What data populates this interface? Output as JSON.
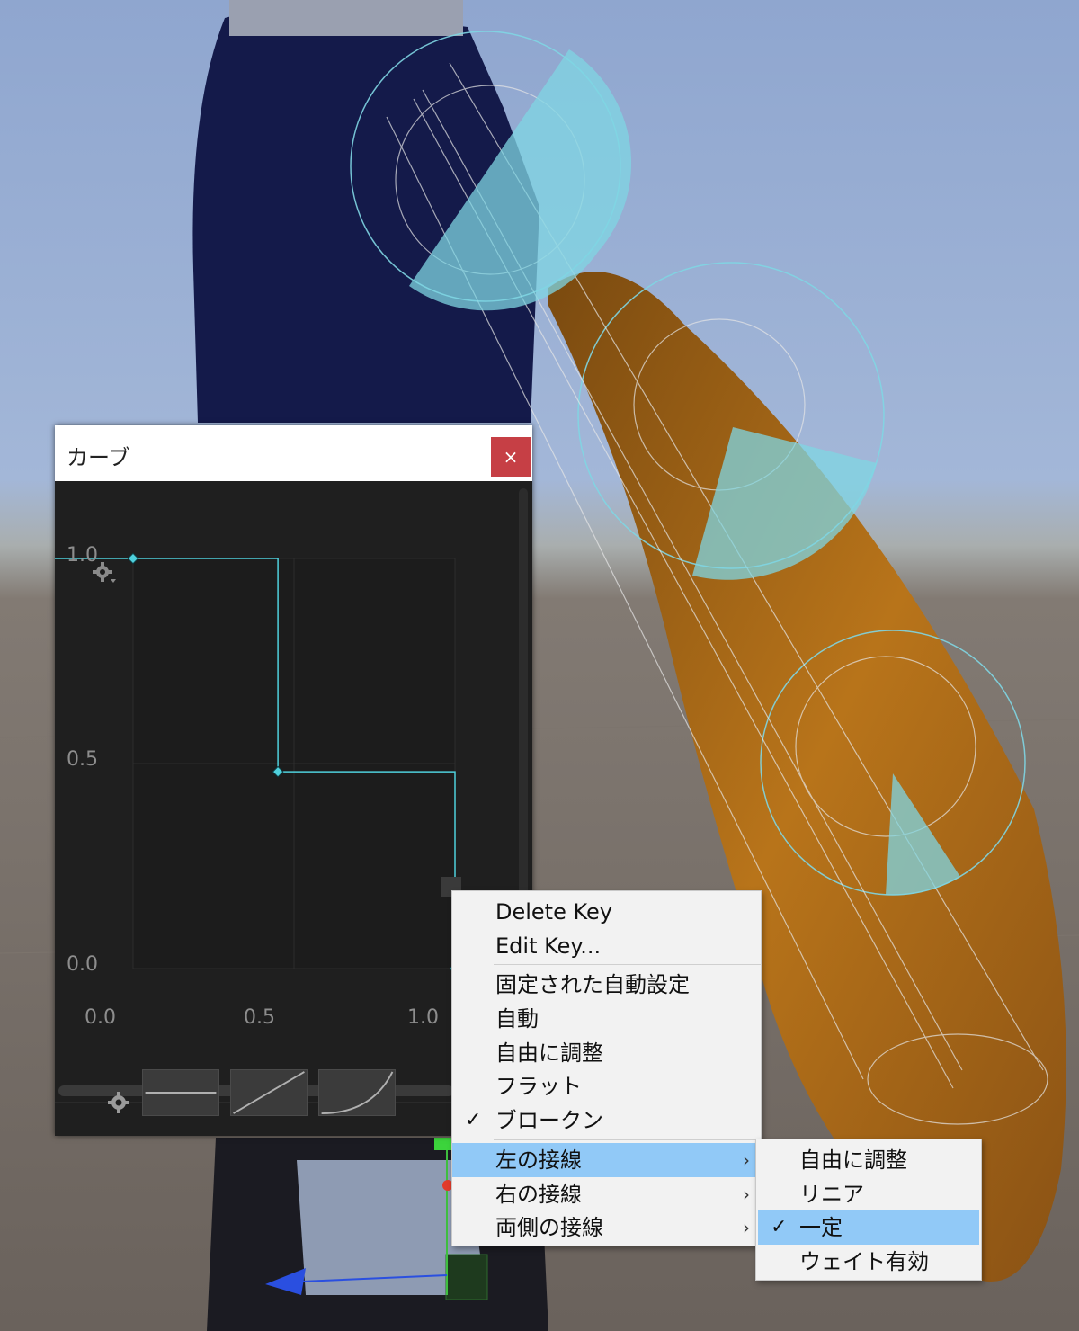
{
  "window": {
    "title": "カーブ",
    "close_glyph": "×"
  },
  "curve": {
    "y_labels": [
      "1.0",
      "0.5",
      "0.0"
    ],
    "x_labels": [
      "0.0",
      "0.5",
      "1.0"
    ],
    "keys": [
      {
        "time": 0.0,
        "value": 1.0
      },
      {
        "time": 0.45,
        "value": 0.48
      },
      {
        "time": 1.0,
        "value": 0.0
      }
    ],
    "accent": "#4fd0dc",
    "presets": [
      "flat",
      "linear",
      "ease-in"
    ]
  },
  "menu": {
    "items": [
      {
        "label": "Delete Key",
        "checked": false
      },
      {
        "label": "Edit Key...",
        "checked": false
      },
      {
        "label": "固定された自動設定",
        "checked": false
      },
      {
        "label": "自動",
        "checked": false
      },
      {
        "label": "自由に調整",
        "checked": false
      },
      {
        "label": "フラット",
        "checked": false
      },
      {
        "label": "ブロークン",
        "checked": true
      },
      {
        "label": "左の接線",
        "submenu": true,
        "highlighted": true
      },
      {
        "label": "右の接線",
        "submenu": true
      },
      {
        "label": "両側の接線",
        "submenu": true
      }
    ],
    "check_glyph": "✓",
    "arrow_glyph": "›"
  },
  "submenu": {
    "items": [
      {
        "label": "自由に調整",
        "checked": false
      },
      {
        "label": "リニア",
        "checked": false
      },
      {
        "label": "一定",
        "checked": true,
        "highlighted": true
      },
      {
        "label": "ウェイト有効",
        "checked": false
      }
    ]
  },
  "colors": {
    "highlight": "#91c9f7",
    "close_button": "#c63f45",
    "gizmo": "#7fd6e3",
    "hair": "#b8741a"
  }
}
